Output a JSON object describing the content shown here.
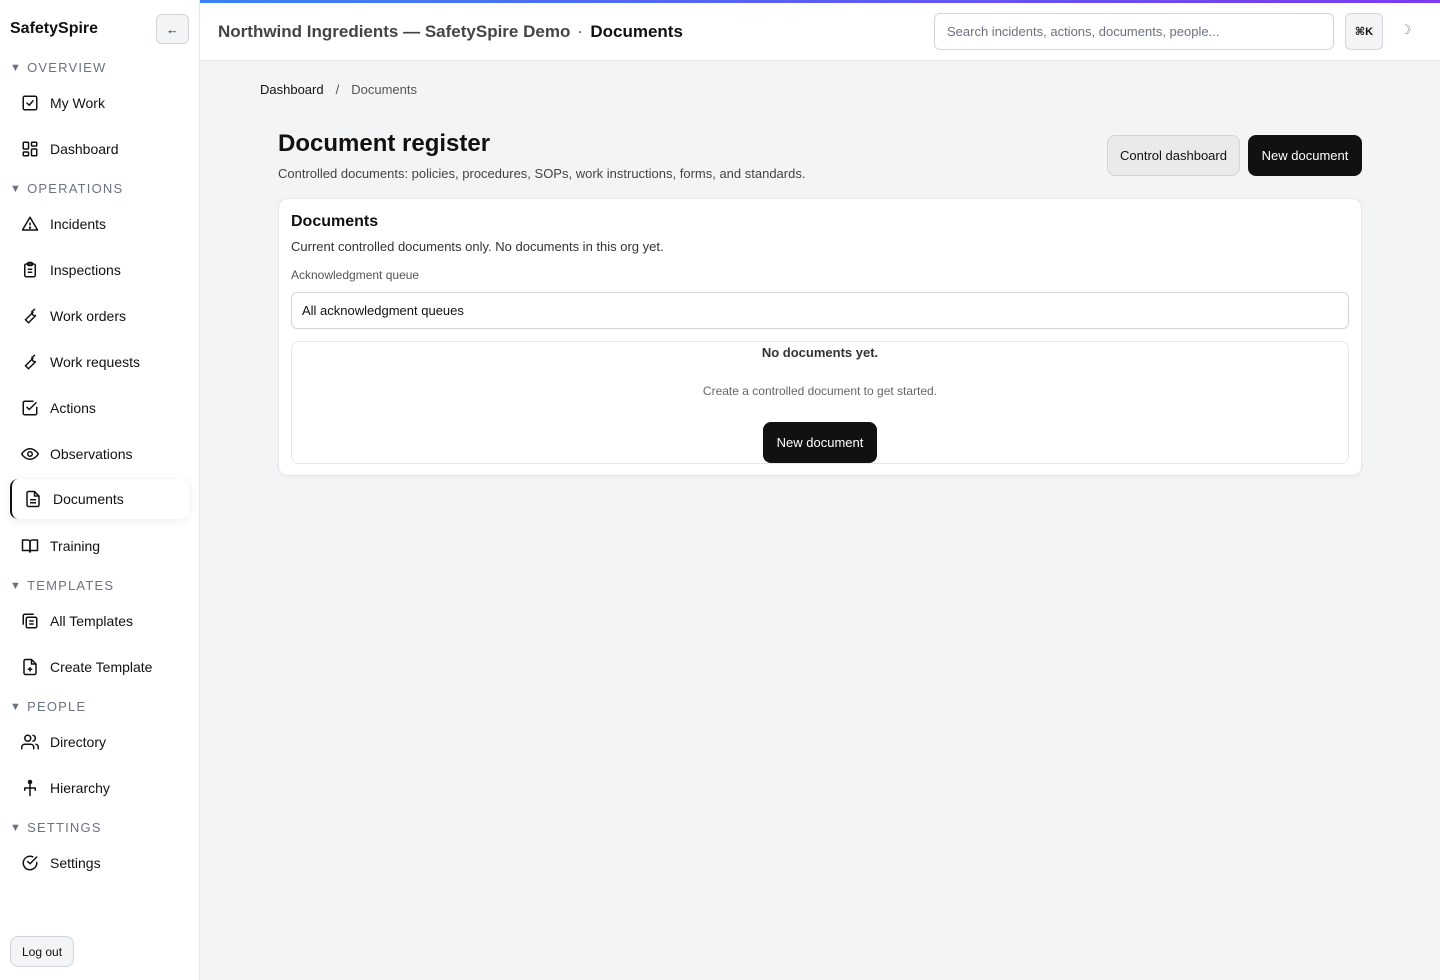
{
  "sidebar": {
    "brand": "SafetySpire",
    "collapse_label": "←",
    "sections": [
      {
        "label": "OVERVIEW",
        "items": [
          {
            "label": "My Work",
            "icon": "check-square-icon"
          },
          {
            "label": "Dashboard",
            "icon": "grid-icon"
          }
        ]
      },
      {
        "label": "OPERATIONS",
        "items": [
          {
            "label": "Incidents",
            "icon": "warning-triangle-icon"
          },
          {
            "label": "Inspections",
            "icon": "clipboard-icon"
          },
          {
            "label": "Work orders",
            "icon": "wrench-icon"
          },
          {
            "label": "Work requests",
            "icon": "wrench-icon"
          },
          {
            "label": "Actions",
            "icon": "check-square-icon"
          },
          {
            "label": "Observations",
            "icon": "eye-icon"
          },
          {
            "label": "Documents",
            "icon": "document-icon"
          },
          {
            "label": "Training",
            "icon": "book-icon"
          }
        ]
      },
      {
        "label": "TEMPLATES",
        "items": [
          {
            "label": "All Templates",
            "icon": "stack-icon"
          },
          {
            "label": "Create Template",
            "icon": "file-plus-icon"
          }
        ]
      },
      {
        "label": "PEOPLE",
        "items": [
          {
            "label": "Directory",
            "icon": "users-icon"
          },
          {
            "label": "Hierarchy",
            "icon": "hierarchy-icon"
          }
        ]
      },
      {
        "label": "SETTINGS",
        "items": [
          {
            "label": "Settings",
            "icon": "check-circle-icon"
          }
        ]
      }
    ],
    "active": "Documents",
    "logout_label": "Log out"
  },
  "topbar": {
    "org_title": "Northwind Ingredients — SafetySpire Demo",
    "separator": "·",
    "page": "Documents",
    "search_placeholder": "Search incidents, actions, documents, people...",
    "shortcut": "⌘K",
    "theme_icon": "☽"
  },
  "breadcrumb": {
    "home": "Dashboard",
    "sep": "/",
    "current": "Documents"
  },
  "page": {
    "title": "Document register",
    "subtitle": "Controlled documents: policies, procedures, SOPs, work instructions, forms, and standards.",
    "control_dashboard_label": "Control dashboard",
    "new_document_label": "New document"
  },
  "card": {
    "title": "Documents",
    "description": "Current controlled documents only. No documents in this org yet.",
    "queue_label": "Acknowledgment queue",
    "queue_value": "All acknowledgment queues",
    "empty_title": "No documents yet.",
    "empty_subtitle": "Create a controlled document to get started.",
    "empty_button": "New document"
  },
  "colors": {
    "accent_start": "#3b82f6",
    "accent_end": "#7c3aed",
    "primary": "#111111"
  }
}
